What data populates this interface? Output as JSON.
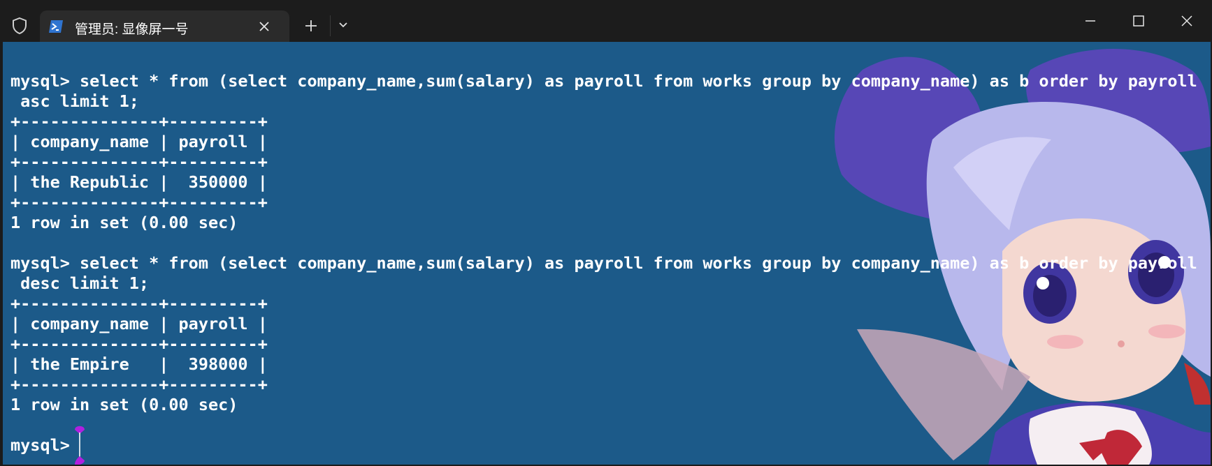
{
  "tab": {
    "title": "管理员: 显像屏一号"
  },
  "icons": {
    "app": "shield-icon",
    "tab": "powershell-icon",
    "tab_close": "close-icon",
    "new_tab": "plus-icon",
    "dropdown": "chevron-down-icon",
    "minimize": "minimize-icon",
    "maximize": "maximize-icon",
    "close": "close-icon"
  },
  "colors": {
    "terminal_bg": "#1c5a89",
    "titlebar_bg": "#1c1c1c",
    "tab_bg": "#2b2b2b",
    "text": "#ffffff",
    "cursor_handle": "#b020e0"
  },
  "terminal": {
    "lines": [
      "mysql> select * from (select company_name,sum(salary) as payroll from works group by company_name) as b order by payroll",
      " asc limit 1;",
      "+--------------+---------+",
      "| company_name | payroll |",
      "+--------------+---------+",
      "| the Republic |  350000 |",
      "+--------------+---------+",
      "1 row in set (0.00 sec)",
      "",
      "mysql> select * from (select company_name,sum(salary) as payroll from works group by company_name) as b order by payroll",
      " desc limit 1;",
      "+--------------+---------+",
      "| company_name | payroll |",
      "+--------------+---------+",
      "| the Empire   |  398000 |",
      "+--------------+---------+",
      "1 row in set (0.00 sec)",
      "",
      "mysql> "
    ]
  }
}
